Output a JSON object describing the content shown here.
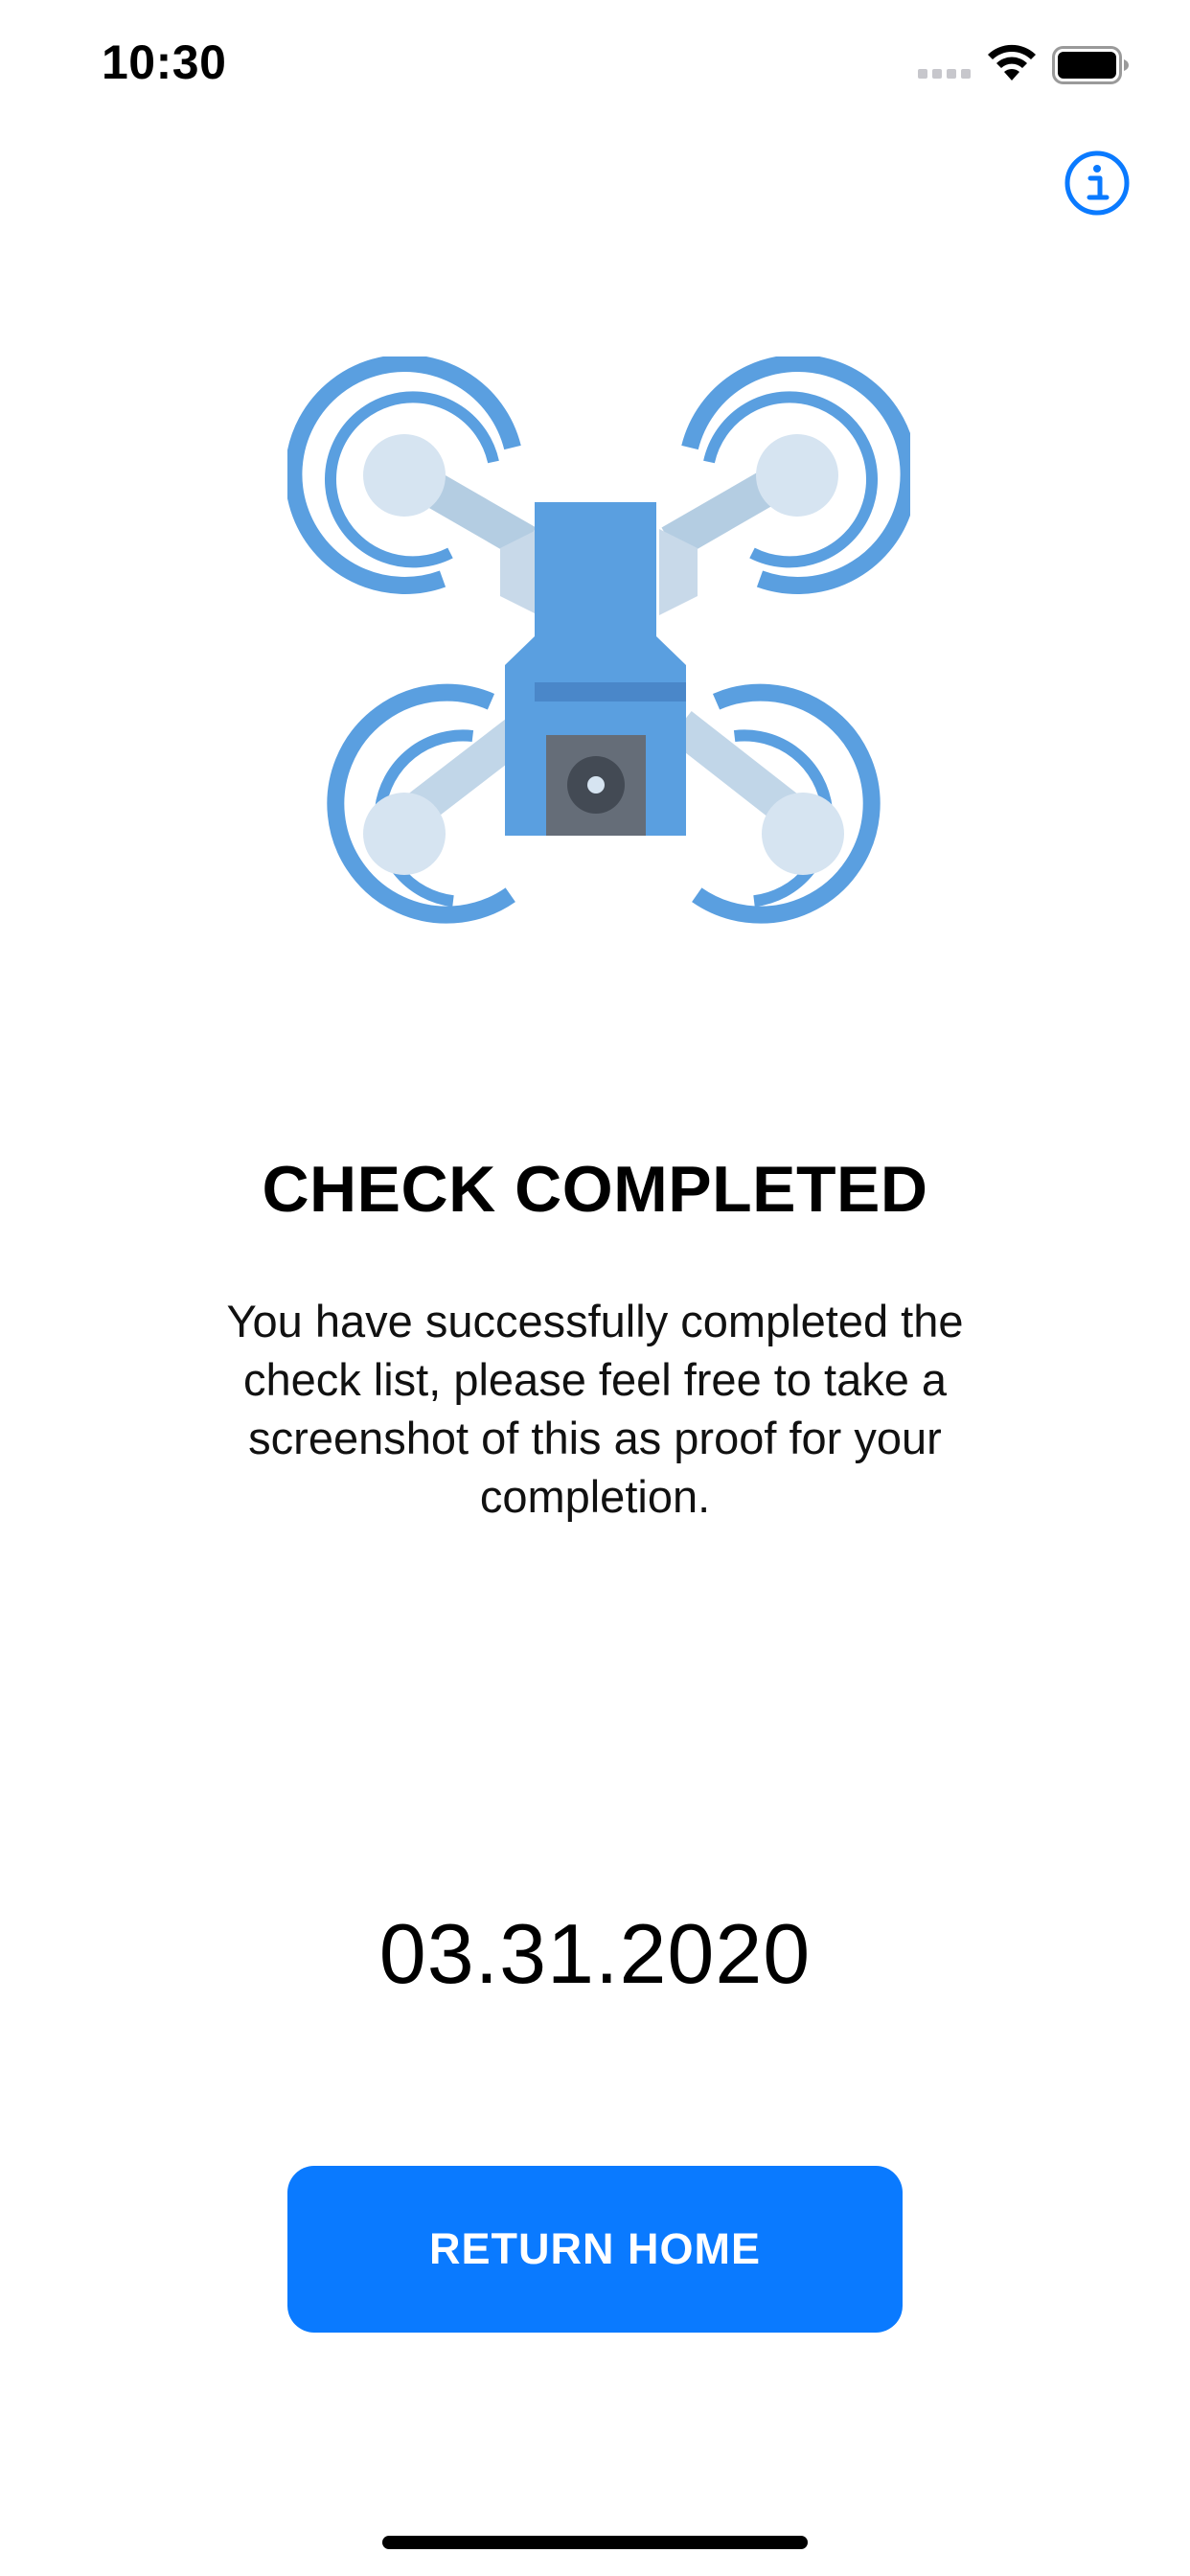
{
  "status_bar": {
    "time": "10:30",
    "icons": [
      "signal-icon",
      "wifi-icon",
      "battery-icon"
    ]
  },
  "header": {
    "info_icon": "info-icon"
  },
  "illustration": {
    "name": "drone-icon",
    "colors": {
      "blue": "#5a9fe0",
      "blue_dark": "#4a87c9",
      "light": "#d6e4f1",
      "arm": "#b4cde2",
      "camera": "#656d78",
      "lens": "#434a54"
    }
  },
  "main": {
    "title": "CHECK COMPLETED",
    "message": "You have successfully completed the check list, please feel free to take a screenshot of this as proof for your completion.",
    "date": "03.31.2020",
    "return_button_label": "RETURN HOME"
  },
  "colors": {
    "accent": "#0a7aff",
    "background": "#ffffff",
    "text": "#000000"
  }
}
